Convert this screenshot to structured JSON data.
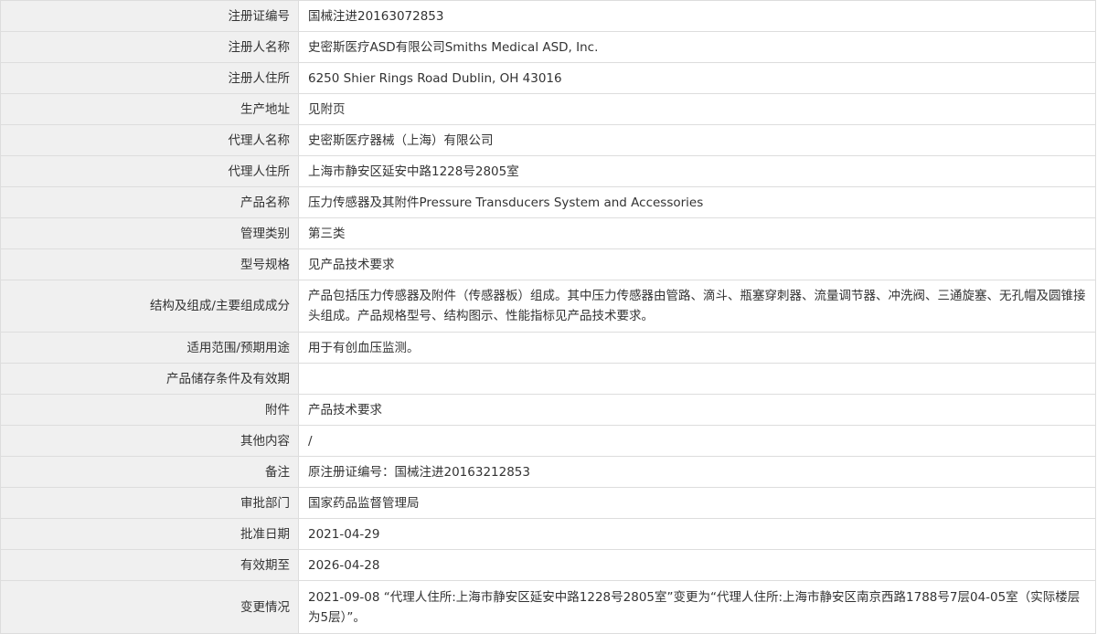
{
  "record": {
    "fields": [
      {
        "label": "注册证编号",
        "value": "国械注进20163072853"
      },
      {
        "label": "注册人名称",
        "value": "史密斯医疗ASD有限公司Smiths Medical ASD, Inc."
      },
      {
        "label": "注册人住所",
        "value": "6250 Shier Rings Road Dublin, OH 43016"
      },
      {
        "label": "生产地址",
        "value": "见附页"
      },
      {
        "label": "代理人名称",
        "value": "史密斯医疗器械（上海）有限公司"
      },
      {
        "label": "代理人住所",
        "value": "上海市静安区延安中路1228号2805室"
      },
      {
        "label": "产品名称",
        "value": "压力传感器及其附件Pressure Transducers System and Accessories"
      },
      {
        "label": "管理类别",
        "value": "第三类"
      },
      {
        "label": "型号规格",
        "value": "见产品技术要求"
      },
      {
        "label": "结构及组成/主要组成成分",
        "value": "产品包括压力传感器及附件（传感器板）组成。其中压力传感器由管路、滴斗、瓶塞穿刺器、流量调节器、冲洗阀、三通旋塞、无孔帽及圆锥接头组成。产品规格型号、结构图示、性能指标见产品技术要求。"
      },
      {
        "label": "适用范围/预期用途",
        "value": "用于有创血压监测。"
      },
      {
        "label": "产品储存条件及有效期",
        "value": ""
      },
      {
        "label": "附件",
        "value": "产品技术要求"
      },
      {
        "label": "其他内容",
        "value": "/"
      },
      {
        "label": "备注",
        "value": "原注册证编号：国械注进20163212853"
      },
      {
        "label": "审批部门",
        "value": "国家药品监督管理局"
      },
      {
        "label": "批准日期",
        "value": "2021-04-29"
      },
      {
        "label": "有效期至",
        "value": "2026-04-28"
      },
      {
        "label": "变更情况",
        "value": "2021-09-08 “代理人住所:上海市静安区延安中路1228号2805室”变更为“代理人住所:上海市静安区南京西路1788号7层04-05室（实际楼层为5层）”。"
      }
    ]
  },
  "colors": {
    "label_background": "#f0f0f0",
    "value_background": "#ffffff",
    "border": "#dddddd",
    "text": "#333333"
  }
}
